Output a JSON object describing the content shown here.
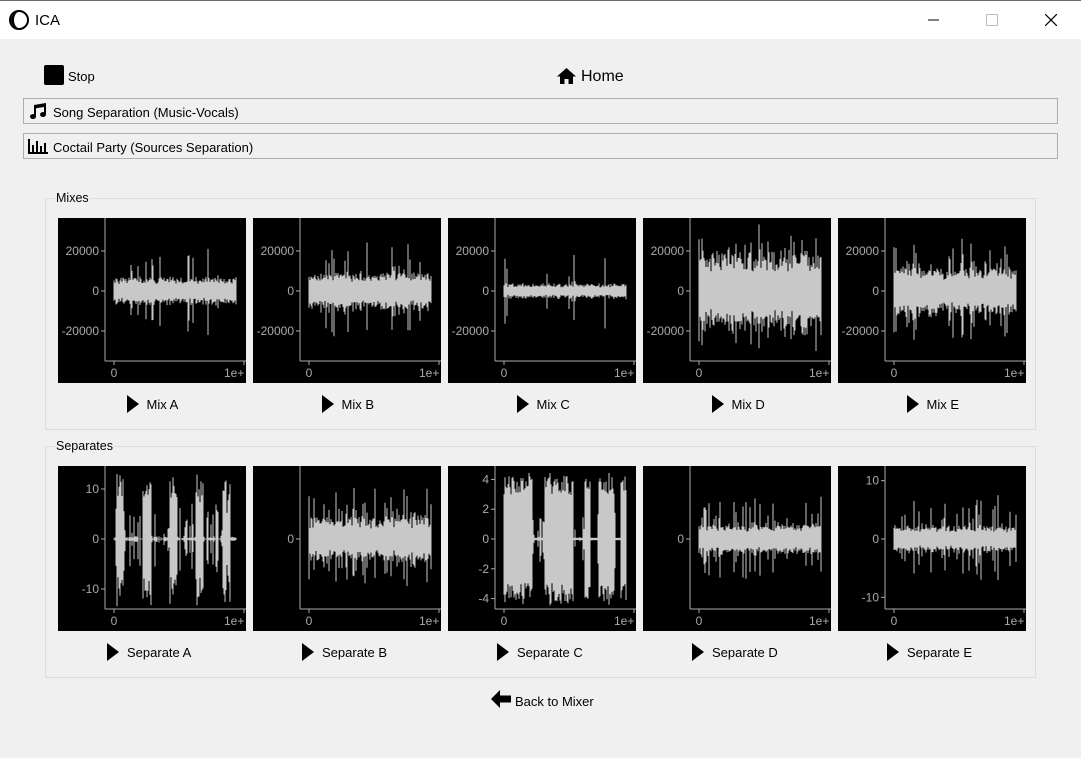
{
  "window": {
    "title": "ICA",
    "icon": "ica-logo-icon",
    "controls": [
      "minimize-icon",
      "maximize-icon",
      "close-icon"
    ]
  },
  "toolbar": {
    "stop_label": "Stop",
    "stop_icon": "stop-icon",
    "home_label": "Home",
    "home_icon": "home-icon"
  },
  "modes": [
    {
      "label": "Song Separation (Music-Vocals)",
      "icon": "music-note-icon"
    },
    {
      "label": "Coctail Party (Sources Separation)",
      "icon": "equalizer-icon"
    }
  ],
  "mixes": {
    "title": "Mixes",
    "plots": [
      {
        "label": "Mix A",
        "yticks": [
          "20000",
          "0",
          "-20000"
        ],
        "xticks": [
          "0",
          "1e+"
        ],
        "ylim": [
          -35000,
          35000
        ],
        "amp": 0.22,
        "spikes": 0.25
      },
      {
        "label": "Mix B",
        "yticks": [
          "20000",
          "0",
          "-20000"
        ],
        "xticks": [
          "0",
          "1e+"
        ],
        "ylim": [
          -35000,
          35000
        ],
        "amp": 0.3,
        "spikes": 0.55
      },
      {
        "label": "Mix C",
        "yticks": [
          "20000",
          "0",
          "-20000"
        ],
        "xticks": [
          "0",
          "1e+"
        ],
        "ylim": [
          -35000,
          35000
        ],
        "amp": 0.12,
        "spikes": 0.2
      },
      {
        "label": "Mix D",
        "yticks": [
          "20000",
          "0",
          "-20000"
        ],
        "xticks": [
          "0",
          "1e+"
        ],
        "ylim": [
          -35000,
          35000
        ],
        "amp": 0.6,
        "spikes": 0.7
      },
      {
        "label": "Mix E",
        "yticks": [
          "20000",
          "0",
          "-20000"
        ],
        "xticks": [
          "0",
          "1e+"
        ],
        "ylim": [
          -35000,
          35000
        ],
        "amp": 0.38,
        "spikes": 0.7
      }
    ]
  },
  "separates": {
    "title": "Separates",
    "plots": [
      {
        "label": "Separate A",
        "yticks": [
          "10",
          "0",
          "-10"
        ],
        "xticks": [
          "0",
          "1e+"
        ],
        "ylim": [
          -14,
          14
        ],
        "amp": 0.05,
        "spikes": 0.9,
        "bursty": true
      },
      {
        "label": "Separate B",
        "yticks": [
          "0"
        ],
        "xticks": [
          "0",
          "1e+"
        ],
        "ylim": [
          -14,
          14
        ],
        "amp": 0.35,
        "spikes": 0.85
      },
      {
        "label": "Separate C",
        "yticks": [
          "4",
          "2",
          "0",
          "-2",
          "-4"
        ],
        "xticks": [
          "0",
          "1e+"
        ],
        "ylim": [
          -4.7,
          4.7
        ],
        "amp": 0.9,
        "spikes": 0.95,
        "blocky": true
      },
      {
        "label": "Separate D",
        "yticks": [
          "0"
        ],
        "xticks": [
          "0",
          "1e+"
        ],
        "ylim": [
          -14,
          14
        ],
        "amp": 0.25,
        "spikes": 0.6
      },
      {
        "label": "Separate E",
        "yticks": [
          "10",
          "0",
          "-10"
        ],
        "xticks": [
          "0",
          "1e+"
        ],
        "ylim": [
          -12,
          12
        ],
        "amp": 0.22,
        "spikes": 0.6
      }
    ]
  },
  "chart_style": {
    "background": "#000000",
    "trace": "#c8c8c8",
    "axis": "#aaaaaa"
  },
  "back": {
    "label": "Back to Mixer",
    "icon": "arrow-left-icon"
  }
}
